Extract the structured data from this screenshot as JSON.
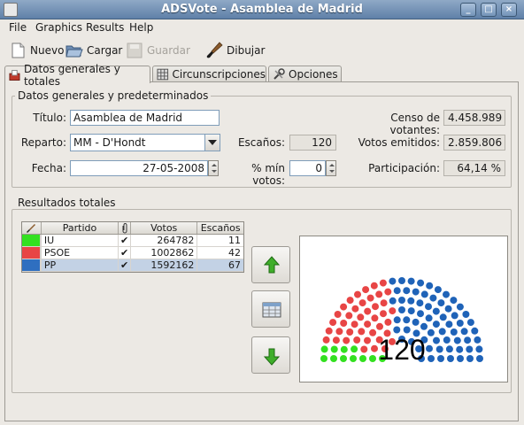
{
  "window": {
    "title": "ADSVote - Asamblea de Madrid",
    "buttons": [
      "_",
      "□",
      "×"
    ]
  },
  "menu": [
    "File",
    "Graphics",
    "Results",
    "Help"
  ],
  "toolbar": {
    "nuevo": "Nuevo",
    "cargar": "Cargar",
    "guardar": "Guardar",
    "dibujar": "Dibujar"
  },
  "tabs": [
    "Datos generales y totales",
    "Circunscripciones",
    "Opciones"
  ],
  "general": {
    "section_title": "Datos generales y predeterminados",
    "titulo_label": "Título:",
    "titulo_value": "Asamblea de Madrid",
    "reparto_label": "Reparto:",
    "reparto_value": "MM - D'Hondt",
    "fecha_label": "Fecha:",
    "fecha_value": "27-05-2008",
    "escanos_label": "Escaños:",
    "escanos_value": "120",
    "min_votos_label": "% mín votos:",
    "min_votos_value": "0",
    "censo_label": "Censo de votantes:",
    "censo_value": "4.458.989",
    "emitidos_label": "Votos emitidos:",
    "emitidos_value": "2.859.806",
    "participacion_label": "Participación:",
    "participacion_value": "64,14 %"
  },
  "results": {
    "section_title": "Resultados totales",
    "columns": [
      "",
      "Partido",
      "",
      "Votos",
      "Escaños"
    ],
    "rows": [
      {
        "party": "IU",
        "color": "#33e020",
        "checked": "✔",
        "votes": "264782",
        "seats": "11"
      },
      {
        "party": "PSOE",
        "color": "#e84545",
        "checked": "✔",
        "votes": "1002862",
        "seats": "42"
      },
      {
        "party": "PP",
        "color": "#2f6fc0",
        "checked": "✔",
        "votes": "1592162",
        "seats": "67"
      }
    ],
    "selected_row": 2
  },
  "chart": {
    "total": "120",
    "colors": {
      "IU": "#33e020",
      "PSOE": "#e84545",
      "PP": "#1f63b8"
    }
  },
  "chart_data": {
    "type": "pie",
    "categories": [
      "IU",
      "PSOE",
      "PP"
    ],
    "values": [
      11,
      42,
      67
    ],
    "title": "",
    "annotation": "120"
  }
}
